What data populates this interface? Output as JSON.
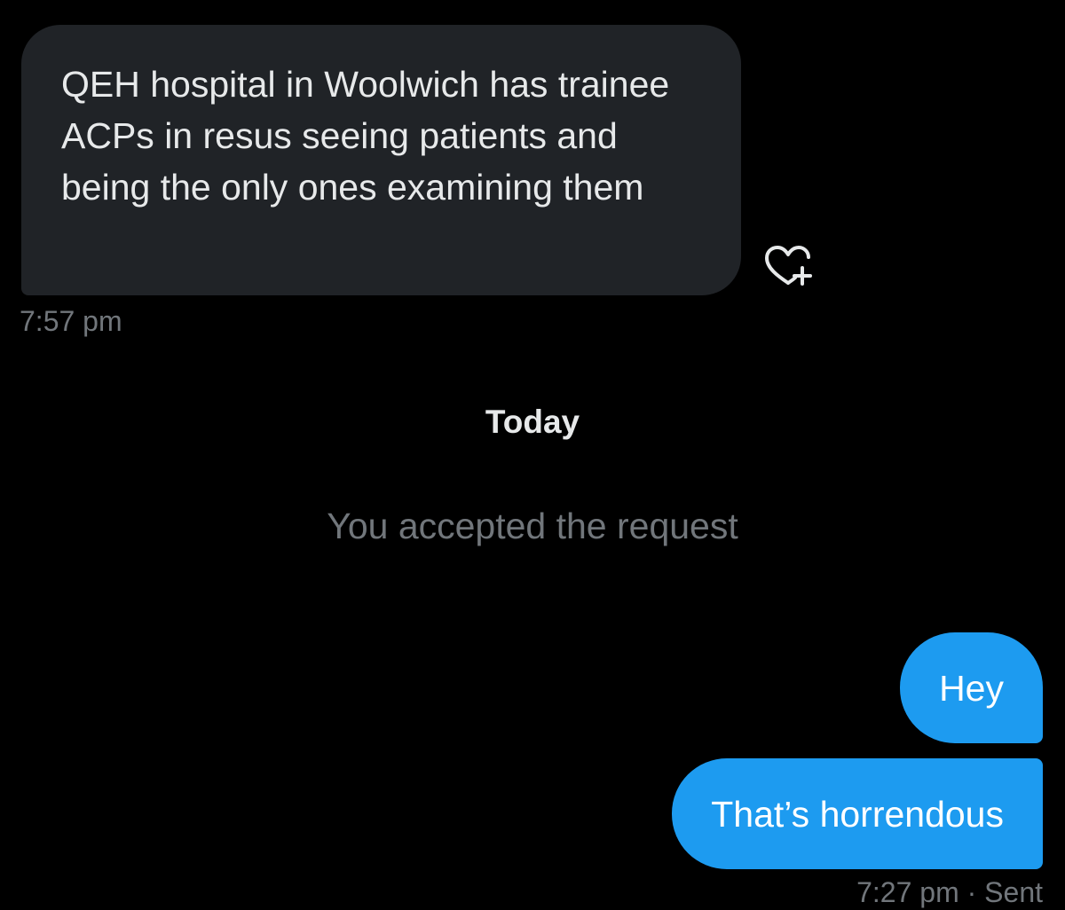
{
  "conversation": {
    "incoming_message": {
      "text": "QEH hospital in Woolwich has trainee ACPs  in resus seeing patients and being the only ones examining them",
      "time": "7:57 pm"
    },
    "date_divider": "Today",
    "system_note": "You accepted the request",
    "outgoing_messages": [
      {
        "text": "Hey"
      },
      {
        "text": "That’s horrendous"
      }
    ],
    "outgoing_status": "7:27 pm · Sent"
  },
  "icons": {
    "like": "heart-plus-icon"
  },
  "colors": {
    "background": "#000000",
    "incoming_bubble": "#202327",
    "outgoing_bubble": "#1d9bf0",
    "primary_text": "#e7e9ea",
    "secondary_text": "#71767b"
  }
}
